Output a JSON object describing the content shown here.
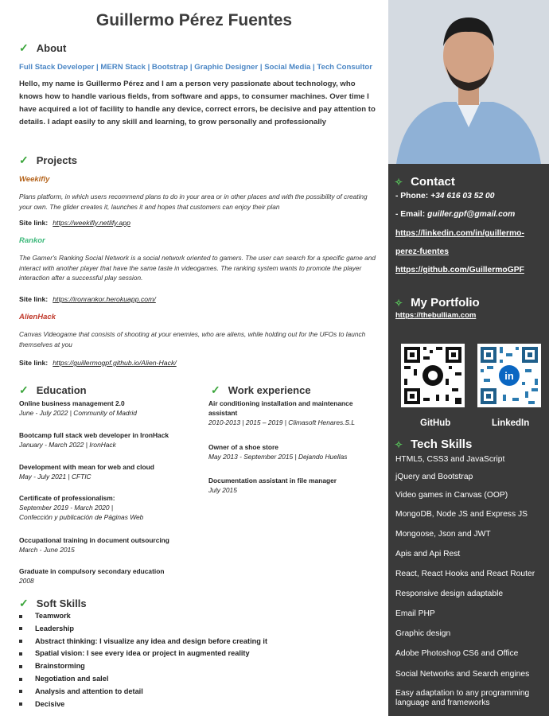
{
  "header": {
    "name": "Guillermo Pérez Fuentes"
  },
  "about": {
    "title": "About",
    "tagline": "Full Stack Developer | MERN Stack | Bootstrap | Graphic Designer | Social Media | Tech Consultor",
    "intro": "Hello, my name is Guillermo Pérez and I am a person very passionate about technology, who knows how to handle various fields, from software and apps, to consumer machines. Over time I have acquired a lot of facility to handle any device, correct errors, be decisive and pay attention to details. I adapt easily to any skill and learning, to grow personally and professionally"
  },
  "projects": {
    "title": "Projects",
    "link_label": "Site link:",
    "items": [
      {
        "name": "Weekifly",
        "color": "#b5651d",
        "desc": "Plans platform, in which users recommend plans to do in your area or in other places and with the possibility of creating your own. The glider creates it, launches it and hopes that customers can enjoy their plan",
        "link": "https://weekifly.netlify.app"
      },
      {
        "name": "Rankor",
        "color": "#3cb87a",
        "desc": "The Gamer's Ranking Social Network is a social network oriented to gamers. The user can search for a specific game and interact with another player that have the same taste in videogames. The ranking system wants to promote the player interaction after a successful play session.",
        "link": "https://ironrankor.herokuapp.com/"
      },
      {
        "name": "AlienHack",
        "color": "#c0392b",
        "desc": "Canvas Videogame that consists of shooting at your enemies, who are aliens, while holding out for the UFOs to launch themselves at you",
        "link": "https://guillermogpf.github.io/Alien-Hack/"
      }
    ]
  },
  "education": {
    "title": "Education",
    "items": [
      {
        "title": "Online business management 2.0",
        "sub": "June - July 2022 | Community of Madrid"
      },
      {
        "title": "Bootcamp full stack web developer in IronHack",
        "sub": "January - March 2022 | IronHack"
      },
      {
        "title": "Development with mean for web and cloud",
        "sub": "May - July 2021 | CFTIC"
      },
      {
        "title": "Certificate of professionalism:",
        "sub": "September 2019 - March 2020 |",
        "sub2": "Confección y publicación de Páginas Web"
      },
      {
        "title": "Occupational training in document outsourcing",
        "sub": "March - June 2015"
      },
      {
        "title": "Graduate in compulsory secondary education",
        "sub": "2008"
      }
    ]
  },
  "work": {
    "title": "Work experience",
    "items": [
      {
        "title": "Air conditioning installation and maintenance assistant",
        "sub": "2010-2013 | 2015 – 2019 | Climasoft Henares.S.L"
      },
      {
        "title": "Owner of a shoe store",
        "sub": "May 2013  - September 2015 | Dejando Huellas"
      },
      {
        "title": "Documentation assistant in file manager",
        "sub": "July 2015"
      }
    ]
  },
  "soft_skills": {
    "title": "Soft Skills",
    "items": [
      "Teamwork",
      "Leadership",
      "Abstract thinking: I visualize any idea and design before creating it",
      "Spatial vision: I see every idea or project in augmented reality",
      "Brainstorming",
      "Negotiation and salel",
      "Analysis and attention to detail",
      "Decisive"
    ]
  },
  "contact": {
    "title": "Contact",
    "phone_label": "- Phone:",
    "phone": "+34 616 03 52 00",
    "email_label": "- Email:",
    "email": "guiller.gpf@gmail.com",
    "linkedin_1": "https://linkedin.com/in/guillermo-",
    "linkedin_2": "perez-fuentes",
    "github": "https://github.com/GuillermoGPF"
  },
  "portfolio": {
    "title": "My Portfolio",
    "link": "https://thebulliam.com",
    "qr_github_caption": "GitHub",
    "qr_linkedin_caption": "LinkedIn"
  },
  "tech": {
    "title": "Tech Skills",
    "items": [
      "HTML5,  CSS3 and JavaScript",
      "jQuery and Bootstrap",
      "Video games in Canvas (OOP)",
      "MongoDB, Node JS and Express JS",
      "Mongoose, Json and JWT",
      "Apis and Api Rest",
      "React, React Hooks and React Router",
      "Responsive design adaptable",
      "Email PHP",
      "Graphic design",
      "Adobe Photoshop CS6 and Office",
      "Social Networks and Search engines",
      "Easy adaptation to any programming language and frameworks"
    ]
  },
  "colors": {
    "sidebar": "#3a3a3a",
    "accent_blue": "#4a86c5",
    "check_green": "#3aa53a"
  }
}
